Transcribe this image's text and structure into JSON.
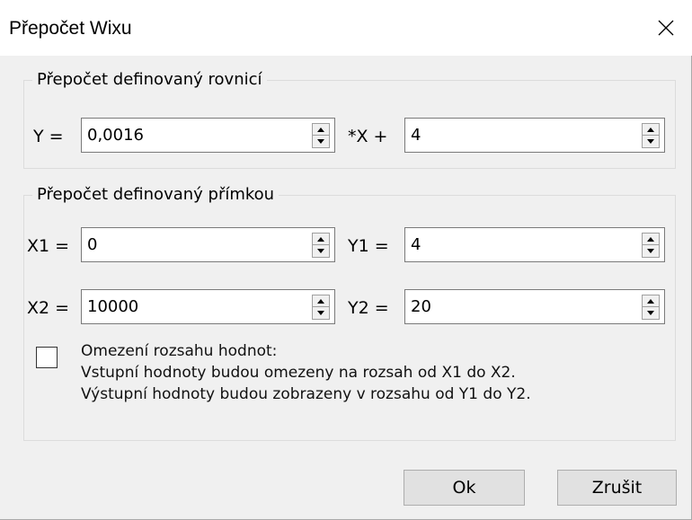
{
  "window": {
    "title": "Přepočet Wixu"
  },
  "equation_group": {
    "label": "Přepočet definovaný rovnicí",
    "y_label": "Y =",
    "coef_value": "0,0016",
    "times_x_label": "*X +",
    "offset_value": "4"
  },
  "line_group": {
    "label": "Přepočet definovaný přímkou",
    "x1_label": "X1 =",
    "x1_value": "0",
    "y1_label": "Y1 =",
    "y1_value": "4",
    "x2_label": "X2 =",
    "x2_value": "10000",
    "y2_label": "Y2 =",
    "y2_value": "20",
    "range_limit": {
      "checked": false,
      "line1": "Omezení rozsahu hodnot:",
      "line2": "Vstupní hodnoty budou omezeny na rozsah od X1 do  X2.",
      "line3": "Výstupní hodnoty budou zobrazeny v rozsahu od Y1 do  Y2."
    }
  },
  "buttons": {
    "ok": "Ok",
    "cancel": "Zrušit"
  },
  "icons": {
    "close": "close-icon",
    "spin_up": "arrow-up-icon",
    "spin_down": "arrow-down-icon"
  }
}
